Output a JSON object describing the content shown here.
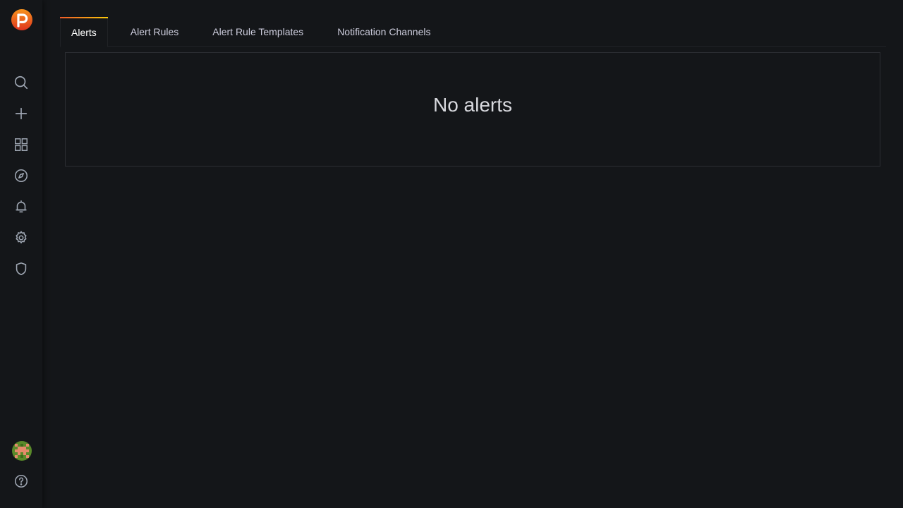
{
  "tabs": [
    {
      "label": "Alerts"
    },
    {
      "label": "Alert Rules"
    },
    {
      "label": "Alert Rule Templates"
    },
    {
      "label": "Notification Channels"
    }
  ],
  "active_tab": "Alerts",
  "panel": {
    "empty_message": "No alerts"
  },
  "sidebar": {
    "items": [
      {
        "icon": "search-icon"
      },
      {
        "icon": "plus-icon"
      },
      {
        "icon": "dashboards-icon"
      },
      {
        "icon": "compass-icon"
      },
      {
        "icon": "bell-icon"
      },
      {
        "icon": "gear-icon"
      },
      {
        "icon": "shield-icon"
      }
    ],
    "bottom": [
      {
        "icon": "avatar"
      },
      {
        "icon": "help-icon"
      }
    ]
  },
  "colors": {
    "background": "#141619",
    "active_tab_accent_start": "#f05a28",
    "active_tab_accent_end": "#fbca0a",
    "icon_color": "#9fa7b3"
  }
}
